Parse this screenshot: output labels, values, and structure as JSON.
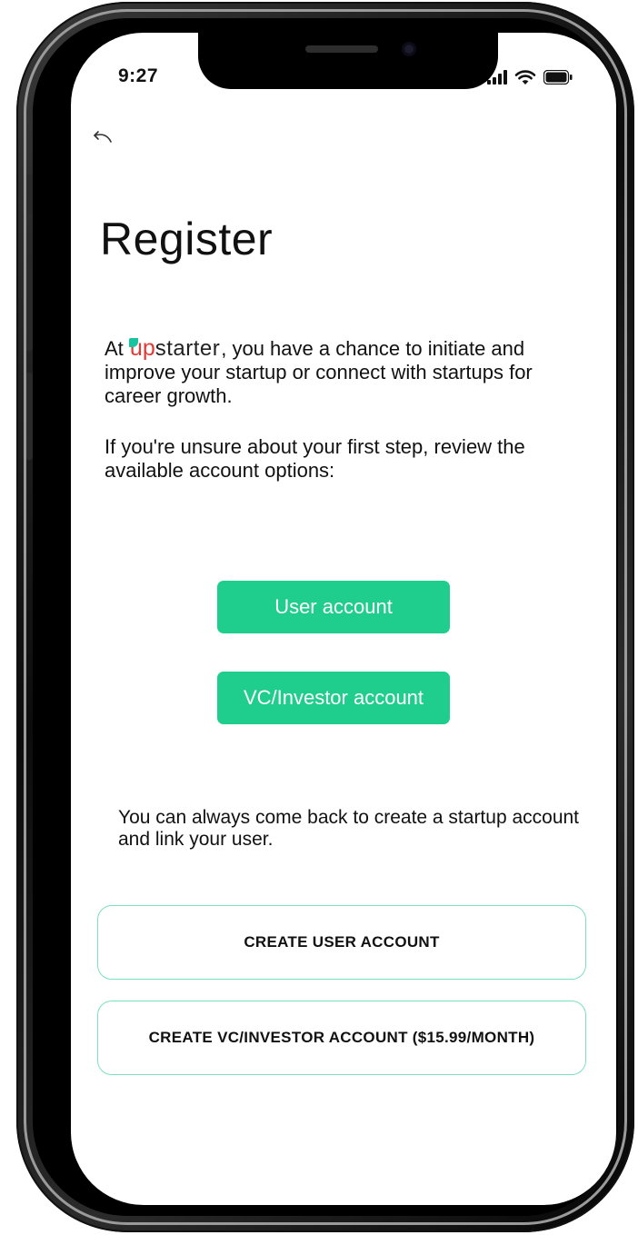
{
  "status_bar": {
    "time": "9:27",
    "icons": [
      "signal-icon",
      "wifi-icon",
      "battery-icon"
    ]
  },
  "header": {
    "back_icon": "back-arrow-icon",
    "title": "Register"
  },
  "intro": {
    "prefix": "At ",
    "brand_u": "u",
    "brand_p": "p",
    "brand_rest": "starter",
    "suffix": ", you have a chance to initiate and improve your startup or connect with startups for career growth.",
    "second": "If you're unsure about your first step, review the available account options:"
  },
  "options": {
    "user_account": "User account",
    "vc_account": "VC/Investor account"
  },
  "note": "You can always come back to create a startup account and link your user.",
  "actions": {
    "create_user": "CREATE USER ACCOUNT",
    "create_vc": "CREATE VC/INVESTOR ACCOUNT ($15.99/MONTH)"
  },
  "colors": {
    "accent_green": "#1fcd8c",
    "outline_green": "#7be0c2",
    "brand_red": "#e53935",
    "brand_teal": "#16c5a0"
  }
}
